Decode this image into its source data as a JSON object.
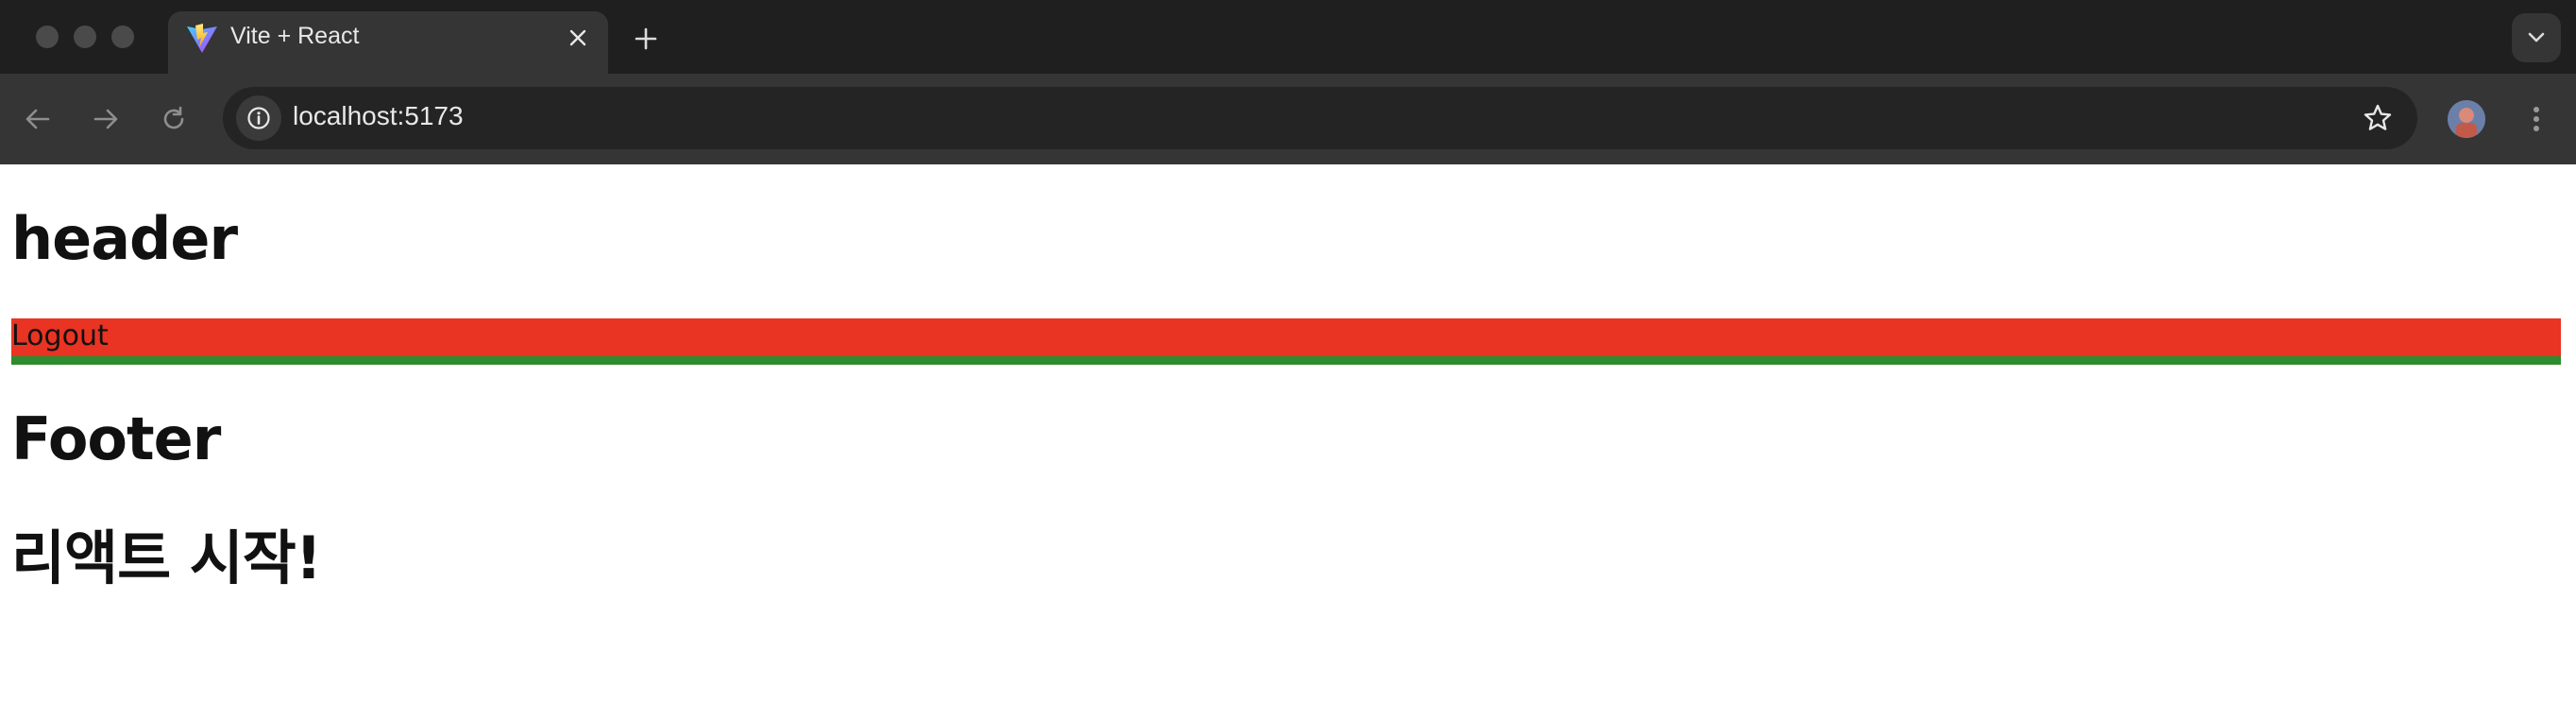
{
  "browser": {
    "tab": {
      "title": "Vite + React",
      "favicon": "vite-logo-icon",
      "close_icon": "close-icon"
    },
    "new_tab_icon": "plus-icon",
    "tab_menu_icon": "chevron-down-icon",
    "toolbar": {
      "back_icon": "arrow-left-icon",
      "forward_icon": "arrow-right-icon",
      "reload_icon": "reload-icon",
      "site_info_icon": "info-icon",
      "url": "localhost:5173",
      "bookmark_icon": "star-icon",
      "menu_icon": "kebab-icon"
    }
  },
  "page": {
    "header_title": "header",
    "logout_label": "Logout",
    "footer_title": "Footer",
    "start_title": "리액트 시작!"
  },
  "colors": {
    "chrome_bg": "#1f1f1f",
    "toolbar_bg": "#353535",
    "omnibox_bg": "#242424",
    "logout_bar": "#e93323",
    "green_strip": "#2e8b2e"
  }
}
